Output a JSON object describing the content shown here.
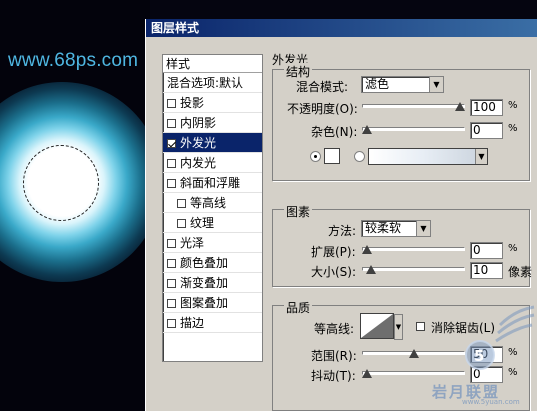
{
  "canvas": {
    "url": "www.68ps.com"
  },
  "dialog": {
    "title": "图层样式",
    "list_header": "样式",
    "items": [
      {
        "label": "混合选项:默认",
        "checkbox": false,
        "checked": false,
        "indent": false,
        "selected": false
      },
      {
        "label": "投影",
        "checkbox": true,
        "checked": false,
        "indent": false,
        "selected": false
      },
      {
        "label": "内阴影",
        "checkbox": true,
        "checked": false,
        "indent": false,
        "selected": false
      },
      {
        "label": "外发光",
        "checkbox": true,
        "checked": true,
        "indent": false,
        "selected": true
      },
      {
        "label": "内发光",
        "checkbox": true,
        "checked": false,
        "indent": false,
        "selected": false
      },
      {
        "label": "斜面和浮雕",
        "checkbox": true,
        "checked": false,
        "indent": false,
        "selected": false
      },
      {
        "label": "等高线",
        "checkbox": true,
        "checked": false,
        "indent": true,
        "selected": false
      },
      {
        "label": "纹理",
        "checkbox": true,
        "checked": false,
        "indent": true,
        "selected": false
      },
      {
        "label": "光泽",
        "checkbox": true,
        "checked": false,
        "indent": false,
        "selected": false
      },
      {
        "label": "颜色叠加",
        "checkbox": true,
        "checked": false,
        "indent": false,
        "selected": false
      },
      {
        "label": "渐变叠加",
        "checkbox": true,
        "checked": false,
        "indent": false,
        "selected": false
      },
      {
        "label": "图案叠加",
        "checkbox": true,
        "checked": false,
        "indent": false,
        "selected": false
      },
      {
        "label": "描边",
        "checkbox": true,
        "checked": false,
        "indent": false,
        "selected": false
      }
    ]
  },
  "outer_glow": {
    "title": "外发光",
    "structure": {
      "title": "结构",
      "blend_mode_label": "混合模式:",
      "blend_mode_value": "滤色",
      "opacity_label": "不透明度(O):",
      "opacity_value": "100",
      "opacity_fraction": 1.0,
      "noise_label": "杂色(N):",
      "noise_value": "0",
      "noise_fraction": 0.0,
      "percent": "%",
      "glow_color": "#ffffff"
    },
    "elements": {
      "title": "图素",
      "technique_label": "方法:",
      "technique_value": "较柔软",
      "spread_label": "扩展(P):",
      "spread_value": "0",
      "spread_fraction": 0.0,
      "size_label": "大小(S):",
      "size_value": "10",
      "size_fraction": 0.04,
      "percent": "%",
      "px_unit": "像素"
    },
    "quality": {
      "title": "品质",
      "contour_label": "等高线:",
      "anti_alias_label": "消除锯齿(L)",
      "range_label": "范围(R):",
      "range_value": "50",
      "range_fraction": 0.5,
      "jitter_label": "抖动(T):",
      "jitter_value": "0",
      "jitter_fraction": 0.0,
      "percent": "%"
    }
  },
  "watermark": {
    "text": "岩月联盟",
    "small": "www.5yuan.com"
  }
}
